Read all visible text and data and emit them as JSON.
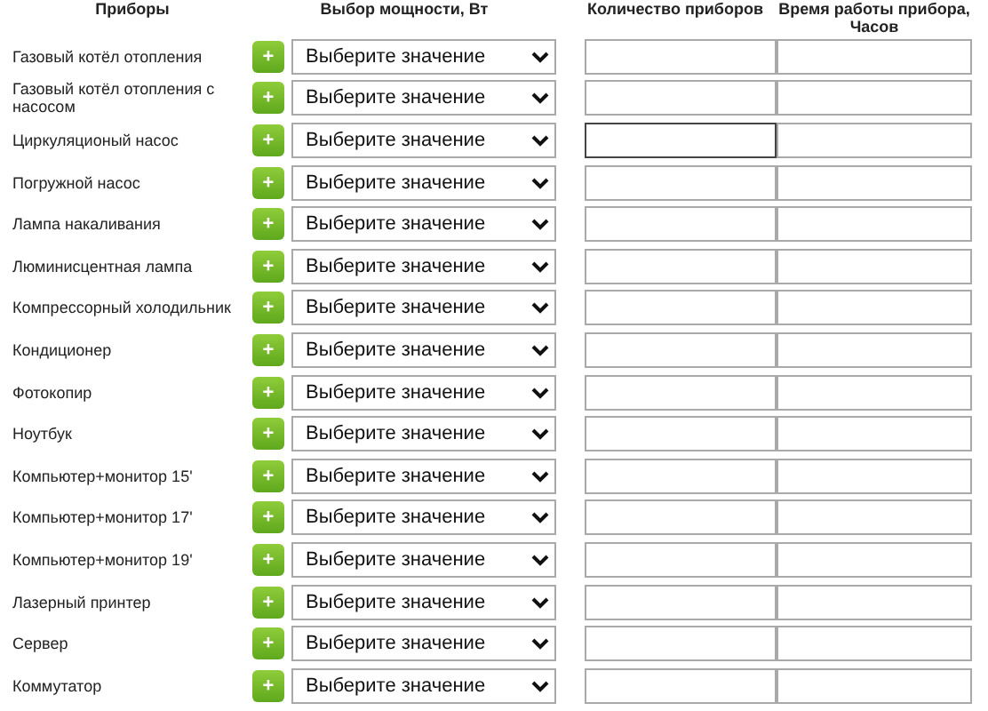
{
  "columns": [
    "Приборы",
    "Выбор мощности, Вт",
    "Количество приборов",
    "Время работы прибора, Часов"
  ],
  "rows": [
    {
      "name": "Газовый котёл отопления",
      "add": "+",
      "power": "Выберите значение",
      "quantity_focused": false
    },
    {
      "name": "Газовый котёл отопления с насосом",
      "add": "+",
      "power": "Выберите значение",
      "quantity_focused": false
    },
    {
      "name": "Циркуляционый насос",
      "add": "+",
      "power": "Выберите значение",
      "quantity_focused": true
    },
    {
      "name": "Погружной насос",
      "add": "+",
      "power": "Выберите значение",
      "quantity_focused": false
    },
    {
      "name": "Лампа накаливания",
      "add": "+",
      "power": "Выберите значение",
      "quantity_focused": false
    },
    {
      "name": "Люминисцентная лампа",
      "add": "+",
      "power": "Выберите значение",
      "quantity_focused": false
    },
    {
      "name": "Компрессорный холодильник",
      "add": "+",
      "power": "Выберите значение",
      "quantity_focused": false
    },
    {
      "name": "Кондиционер",
      "add": "+",
      "power": "Выберите значение",
      "quantity_focused": false
    },
    {
      "name": "Фотокопир",
      "add": "+",
      "power": "Выберите значение",
      "quantity_focused": false
    },
    {
      "name": "Ноутбук",
      "add": "+",
      "power": "Выберите значение",
      "quantity_focused": false
    },
    {
      "name": "Компьютер+монитор 15'",
      "add": "+",
      "power": "Выберите значение",
      "quantity_focused": false
    },
    {
      "name": "Компьютер+монитор 17'",
      "add": "+",
      "power": "Выберите значение",
      "quantity_focused": false
    },
    {
      "name": "Компьютер+монитор 19'",
      "add": "+",
      "power": "Выберите значение",
      "quantity_focused": false
    },
    {
      "name": "Лазерный принтер",
      "add": "+",
      "power": "Выберите значение",
      "quantity_focused": false
    },
    {
      "name": "Сервер",
      "add": "+",
      "power": "Выберите значение",
      "quantity_focused": false
    },
    {
      "name": "Коммутатор",
      "add": "+",
      "power": "Выберите значение",
      "quantity_focused": false
    }
  ]
}
